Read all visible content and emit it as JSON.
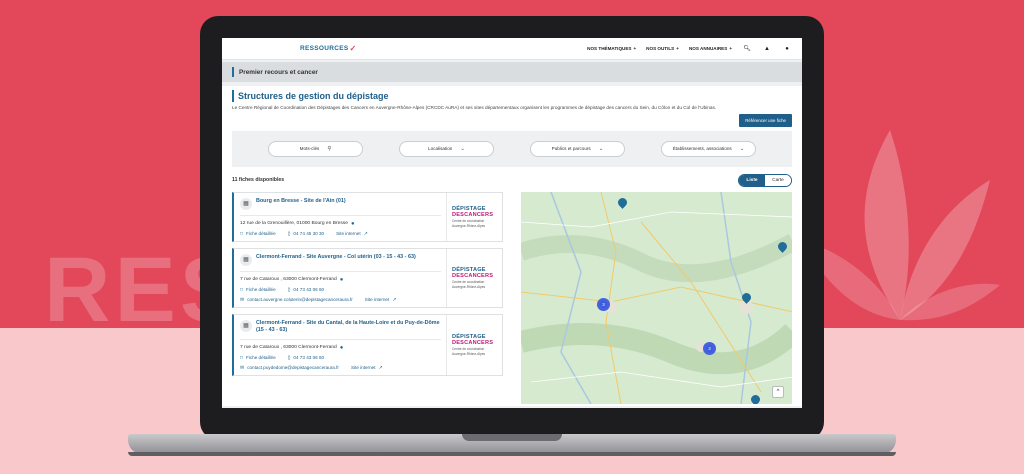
{
  "background": {
    "word": "RESSOURCES",
    "accent": "#e2475a"
  },
  "site": {
    "logo": "RESSOURCES",
    "nav": [
      {
        "label": "NOS THÉMATIQUES",
        "caret": "+"
      },
      {
        "label": "NOS OUTILS",
        "caret": "+"
      },
      {
        "label": "NOS ANNUAIRES",
        "caret": "+"
      }
    ],
    "icons": [
      "search-icon",
      "bell-icon",
      "user-icon"
    ]
  },
  "breadcrumb": "Premier recours et cancer",
  "page": {
    "title": "Structures de gestion du dépistage",
    "intro": "Le Centre Régional de Coordination des Dépistages des Cancers en Auvergne-Rhône-Alpes (CRCDC AuRA) et ses sites départementaux organisent les programmes de dépistage des cancers du Sein, du Côlon et du Col de l’Ubinas.",
    "ref_button": "Référencer une fiche"
  },
  "filters": [
    {
      "label": "Mots-clés",
      "icon": "search-icon"
    },
    {
      "label": "Localisation",
      "icon": "chevron-down-icon"
    },
    {
      "label": "Publics et parcours",
      "icon": "chevron-down-icon"
    },
    {
      "label": "Établissements, associations",
      "icon": "chevron-down-icon"
    }
  ],
  "results": {
    "count": "11 fiches disponibles",
    "view_list": "Liste",
    "view_map": "Carte",
    "active": "Liste"
  },
  "cards": [
    {
      "title": "Bourg en Bresse - Site de l'Ain (01)",
      "address": "12 rue de la Grenouillère, 01000 Bourg en Bresse",
      "pin": "⁰",
      "fiche": "Fiche détaillée",
      "phone": "04 74 45 30 30",
      "site": "Site internet",
      "email": ""
    },
    {
      "title": "Clermont-Ferrand - Site Auvergne - Col utérin (03 - 15 - 43 - 63)",
      "address": "7 rue de Cataroux , 63000 Clermont-Ferrand",
      "pin": "⁰",
      "fiche": "Fiche détaillée",
      "phone": "04 73 43 06 60",
      "site": "Site internet",
      "email": "contact.auvergne.coluterin@depistagecanceraura.fr"
    },
    {
      "title": "Clermont-Ferrand - Site du Cantal, de la Haute-Loire et du Puy-de-Dôme (15 - 43 - 63)",
      "address": "7 rue de Cataroux , 63000 Clermont-Ferrand",
      "pin": "⁰",
      "fiche": "Fiche détaillée",
      "phone": "04 73 43 06 60",
      "site": "Site internet",
      "email": "contact.puydedome@depistagecanceraura.fr"
    }
  ],
  "card_logo": {
    "line1": "DÉPISTAGE",
    "line2": "DESCANCERS",
    "line3": "Centre de coordination",
    "line4": "Auvergne-Rhône-Alpes"
  },
  "map": {
    "clusters": [
      "3",
      "3"
    ],
    "scroll_top": "^"
  }
}
